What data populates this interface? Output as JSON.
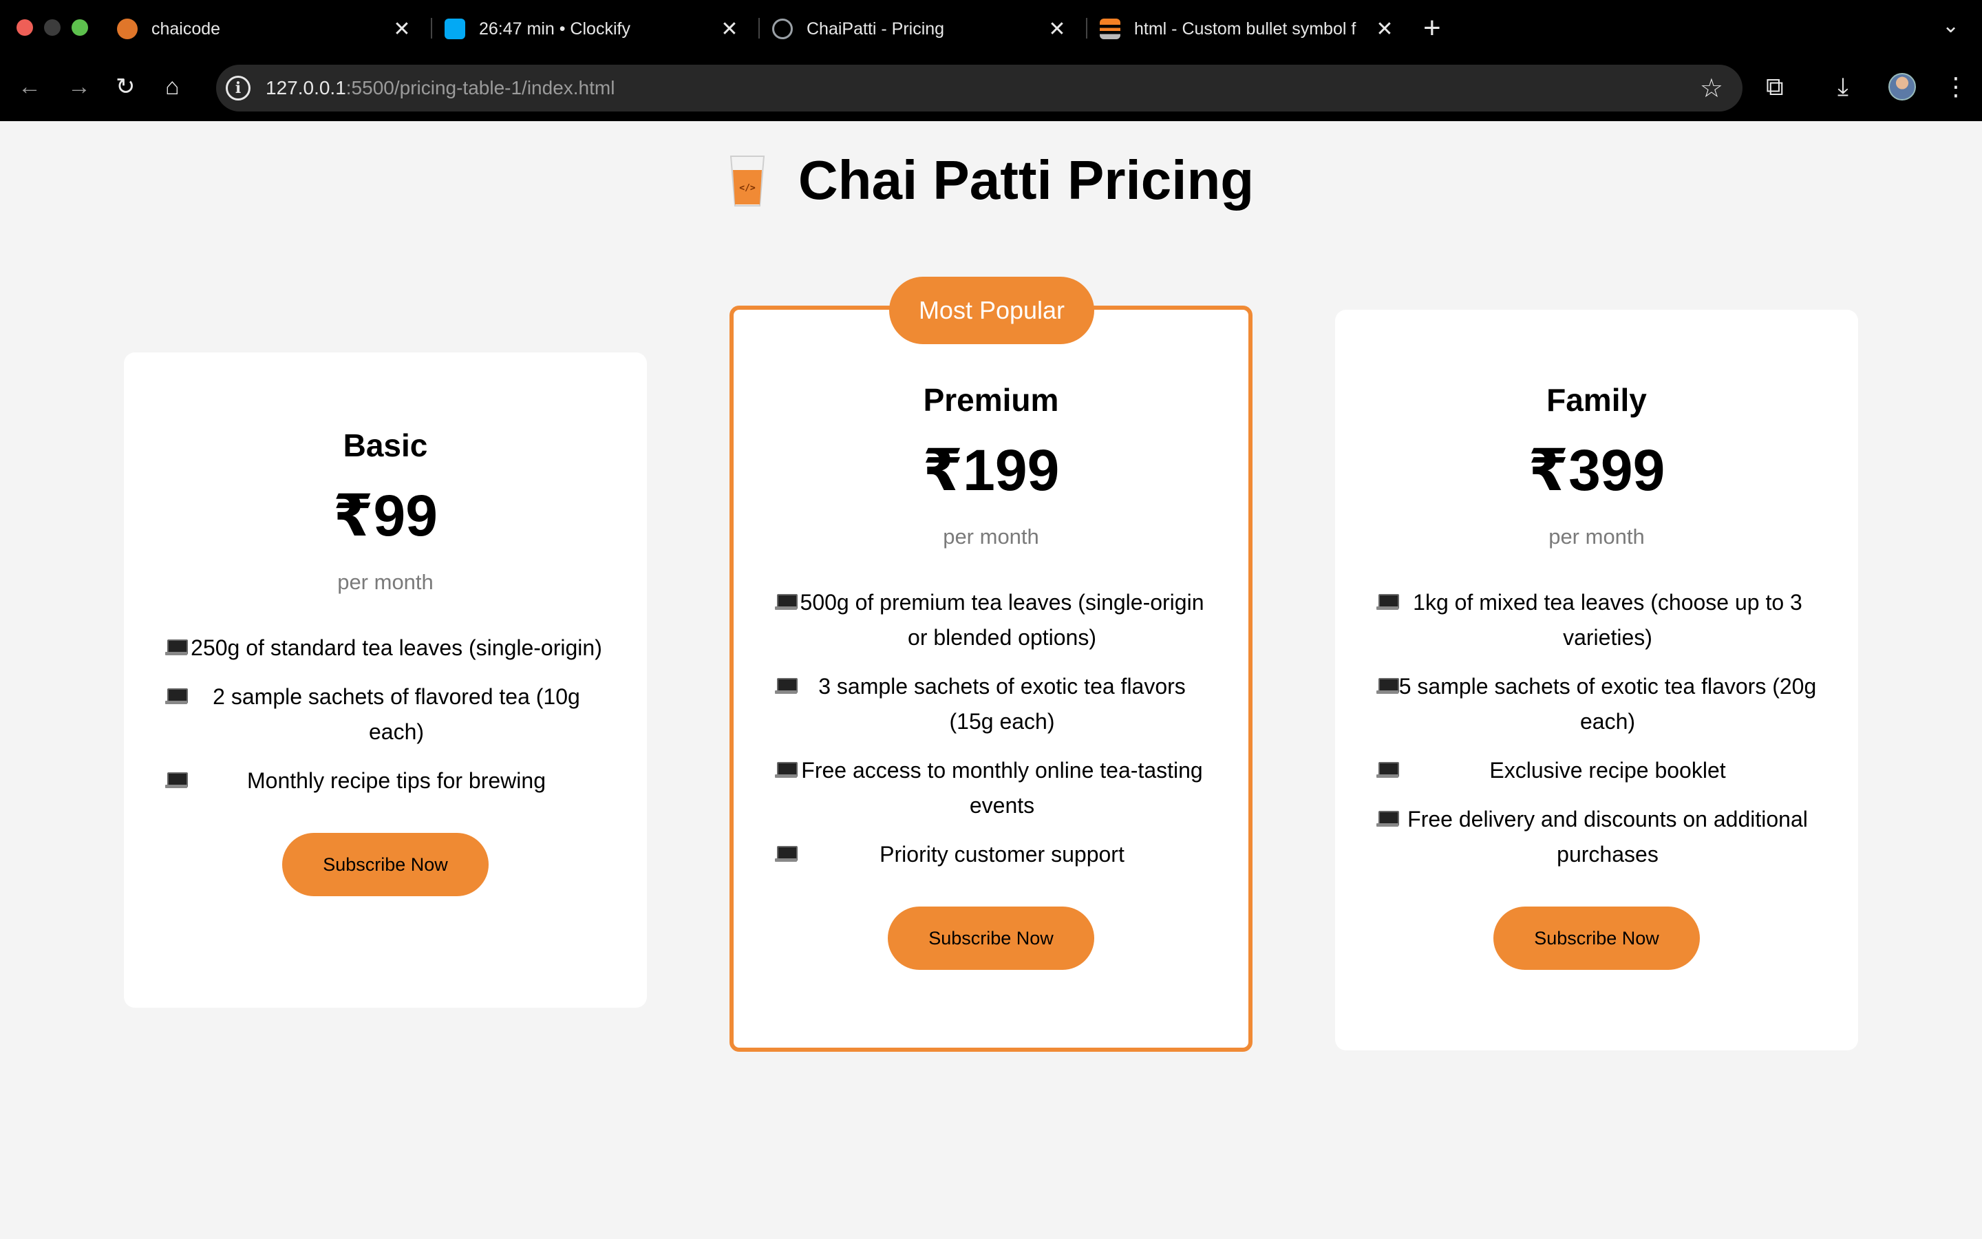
{
  "browser": {
    "tabs": [
      {
        "title": "chaicode",
        "favicon_color": "#e0762a"
      },
      {
        "title": "26:47 min • Clockify",
        "favicon_color": "#03a9f4"
      },
      {
        "title": "ChaiPatti - Pricing",
        "favicon_color": "#9aa0a6"
      },
      {
        "title": "html - Custom bullet symbol f",
        "favicon_color": "#f48024"
      }
    ],
    "url_host": "127.0.0.1",
    "url_path": ":5500/pricing-table-1/index.html"
  },
  "page": {
    "title": "Chai Patti Pricing",
    "accent_color": "#ef8a33"
  },
  "plans": [
    {
      "name": "Basic",
      "price": "₹99",
      "period": "per month",
      "features": [
        "250g of standard tea leaves (single-origin)",
        "2 sample sachets of flavored tea (10g each)",
        "Monthly recipe tips for brewing"
      ],
      "cta": "Subscribe Now"
    },
    {
      "name": "Premium",
      "badge": "Most Popular",
      "price": "₹199",
      "period": "per month",
      "features": [
        "500g of premium tea leaves (single-origin or blended options)",
        "3 sample sachets of exotic tea flavors (15g each)",
        "Free access to monthly online tea-tasting events",
        "Priority customer support"
      ],
      "cta": "Subscribe Now"
    },
    {
      "name": "Family",
      "price": "₹399",
      "period": "per month",
      "features": [
        "1kg of mixed tea leaves (choose up to 3 varieties)",
        "5 sample sachets of exotic tea flavors (20g each)",
        "Exclusive recipe booklet",
        "Free delivery and discounts on additional purchases"
      ],
      "cta": "Subscribe Now"
    }
  ]
}
